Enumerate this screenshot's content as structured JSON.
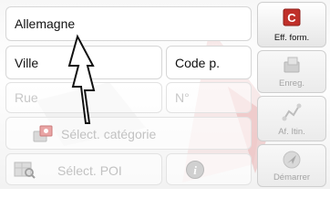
{
  "fields": {
    "country": {
      "value": "Allemagne"
    },
    "city": {
      "placeholder": "Ville"
    },
    "postcode": {
      "placeholder": "Code p."
    },
    "street": {
      "placeholder": "Rue"
    },
    "number": {
      "placeholder": "N°"
    }
  },
  "category": {
    "label": "Sélect. catégorie",
    "icon": "category-icon"
  },
  "poi": {
    "label": "Sélect. POI",
    "icon": "poi-map-icon"
  },
  "info": {
    "icon": "info-icon"
  },
  "side_buttons": {
    "clear": {
      "label": "Eff. form.",
      "icon": "clear-form-icon",
      "color": "#c0302a"
    },
    "save": {
      "label": "Enreg.",
      "icon": "save-icon"
    },
    "route": {
      "label": "Af. Itin.",
      "icon": "route-icon"
    },
    "start": {
      "label": "Démarrer",
      "icon": "start-navigation-icon"
    }
  },
  "colors": {
    "accent": "#c0302a",
    "border": "#d6d6d6",
    "disabled_text": "#c2c2c2"
  }
}
